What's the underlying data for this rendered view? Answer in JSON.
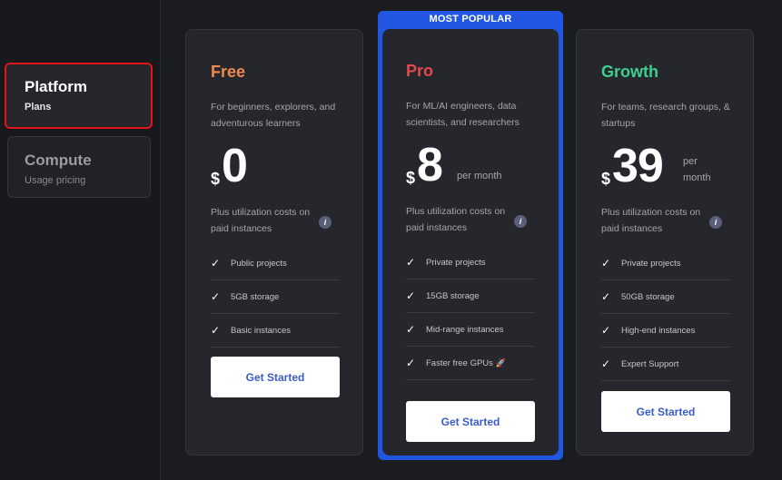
{
  "sidebar": {
    "tabs": [
      {
        "title": "Platform",
        "subtitle": "Plans"
      },
      {
        "title": "Compute",
        "subtitle": "Usage pricing"
      }
    ]
  },
  "badge": "MOST POPULAR",
  "currency": "$",
  "info_glyph": "i",
  "check_glyph": "✓",
  "rocket_glyph": "🚀",
  "colors": {
    "free": "#f0894e",
    "pro": "#e5484d",
    "growth": "#3ecf8e",
    "highlight_border": "#2257e3",
    "selected_tab_outline": "#e0141a"
  },
  "plans": [
    {
      "name": "Free",
      "description": "For beginners, explorers, and adventurous learners",
      "price": "0",
      "period": "",
      "utilization": "Plus utilization costs on paid instances",
      "features": [
        "Public projects",
        "5GB storage",
        "Basic instances"
      ],
      "cta": "Get Started"
    },
    {
      "name": "Pro",
      "description": "For ML/AI engineers, data scientists, and researchers",
      "price": "8",
      "period": "per month",
      "utilization": "Plus utilization costs on paid instances",
      "features": [
        "Private projects",
        "15GB storage",
        "Mid-range instances",
        "Faster free GPUs"
      ],
      "cta": "Get Started"
    },
    {
      "name": "Growth",
      "description": "For teams, research groups, & startups",
      "price": "39",
      "period": "per month",
      "utilization": "Plus utilization costs on paid instances",
      "features": [
        "Private projects",
        "50GB storage",
        "High-end instances",
        "Expert Support"
      ],
      "cta": "Get Started"
    }
  ]
}
